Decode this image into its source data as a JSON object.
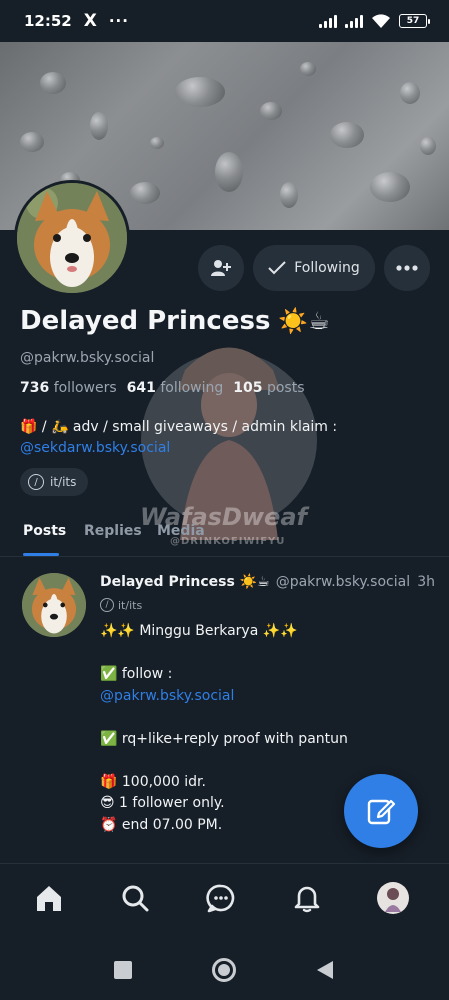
{
  "status_bar": {
    "time": "12:52",
    "x_icon": "X",
    "more": "···",
    "battery": "57"
  },
  "profile": {
    "name": "Delayed Princess",
    "name_emoji": "☀️☕",
    "handle": "@pakrw.bsky.social",
    "followers_count": "736",
    "followers_label": "followers",
    "following_count": "641",
    "following_label": "following",
    "posts_count": "105",
    "posts_label": "posts",
    "bio_line1": "🎁 / 🛵 adv / small giveaways / admin klaim :",
    "bio_link": "@sekdarw.bsky.social",
    "pronoun": "it/its",
    "following_button": "Following"
  },
  "tabs": [
    {
      "label": "Posts",
      "active": true
    },
    {
      "label": "Replies",
      "active": false
    },
    {
      "label": "Media",
      "active": false
    }
  ],
  "watermark": {
    "title": "WafasDweaf",
    "sub": "@DRINKOFIWIFYU"
  },
  "post": {
    "author": "Delayed Princess ☀️☕",
    "handle": "@pakrw.bsky.social",
    "time": "3h",
    "pronoun": "it/its",
    "lines": [
      "✨✨ Minggu Berkarya ✨✨",
      "",
      "✅ follow :",
      "@pakrw.bsky.social",
      "",
      "✅ rq+like+reply proof with pantun",
      "",
      "🎁 100,000 idr.",
      "😎 1 follower only.",
      "⏰  end 07.00 PM."
    ]
  },
  "icons": {
    "add_user": "add-user-icon",
    "more": "more-icon",
    "compose": "compose-icon",
    "home": "home-icon",
    "search": "search-icon",
    "chat": "chat-icon",
    "bell": "bell-icon"
  },
  "colors": {
    "background": "#161e27",
    "accent": "#2f7fe6",
    "surface": "#26303b",
    "muted": "#9aa5b1"
  }
}
